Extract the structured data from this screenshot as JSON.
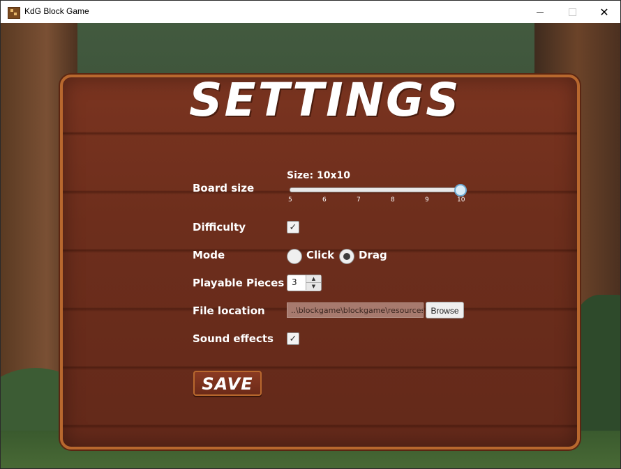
{
  "window": {
    "title": "KdG Block Game",
    "close_glyph": "✕"
  },
  "settings": {
    "heading": "SETTINGS",
    "board_size": {
      "label": "Board size",
      "size_text": "Size: 10x10",
      "value": 10,
      "min": 5,
      "max": 10,
      "ticks": [
        "5",
        "6",
        "7",
        "8",
        "9",
        "10"
      ]
    },
    "difficulty": {
      "label": "Difficulty",
      "checked": true
    },
    "mode": {
      "label": "Mode",
      "options": [
        "Click",
        "Drag"
      ],
      "selected": "Drag"
    },
    "playable_pieces": {
      "label": "Playable Pieces",
      "value": "3"
    },
    "file_location": {
      "label": "File location",
      "value": "..\\blockgame\\blockgame\\resources",
      "browse_label": "Browse"
    },
    "sound_effects": {
      "label": "Sound effects",
      "checked": true
    },
    "save_label": "SAVE"
  },
  "icons": {
    "check": "✓",
    "spin_up": "▲",
    "spin_down": "▼"
  },
  "colors": {
    "board": "#6d2e1c",
    "board_border": "#b8682e",
    "text": "#ffffff",
    "slider_thumb": "#6aa7d0"
  }
}
